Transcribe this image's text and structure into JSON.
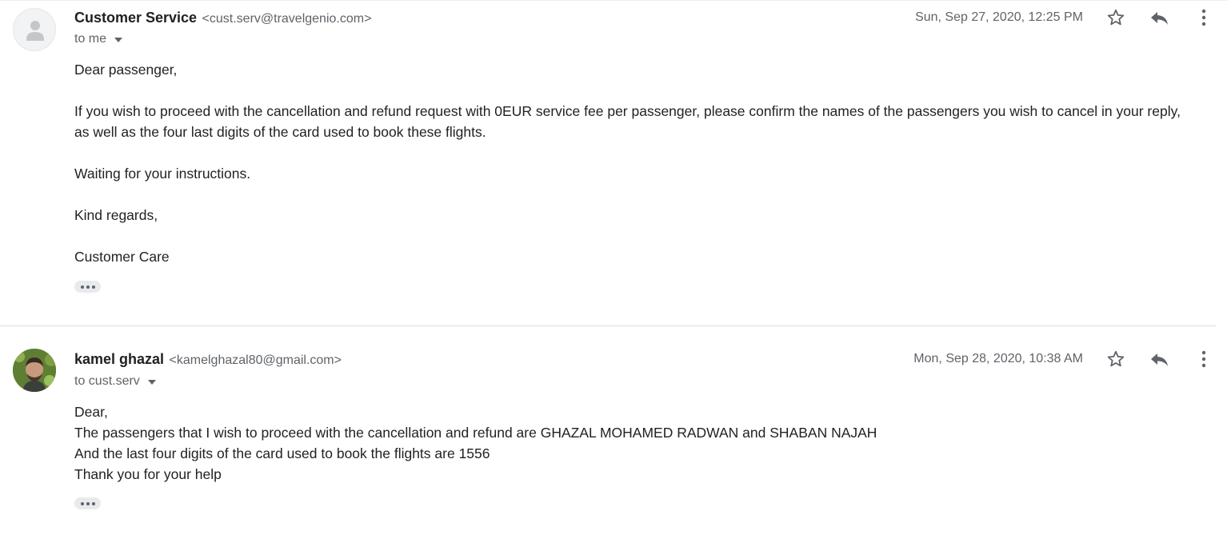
{
  "messages": [
    {
      "sender_name": "Customer Service",
      "sender_email": "<cust.serv@travelgenio.com>",
      "to": "to me",
      "date": "Sun, Sep 27, 2020, 12:25 PM",
      "body": {
        "greeting": "Dear passenger,",
        "para1_line1": "If you wish to proceed with the cancellation and refund request with 0EUR service fee per passenger, please confirm the names of the passengers you wish to cancel in your reply,",
        "para1_line2": "as well as the four last digits of the card used to book these flights.",
        "para2": "Waiting for your instructions.",
        "para3": "Kind regards,",
        "signature": "Customer Care"
      }
    },
    {
      "sender_name": "kamel ghazal",
      "sender_email": "<kamelghazal80@gmail.com>",
      "to": "to cust.serv",
      "date": "Mon, Sep 28, 2020, 10:38 AM",
      "body": {
        "line1": "Dear,",
        "line2": "The passengers that I wish to proceed with the cancellation and refund are GHAZAL MOHAMED RADWAN and SHABAN NAJAH",
        "line3": "And the last four digits of the card used to book the flights are 1556",
        "line4": "Thank you for your help"
      }
    }
  ],
  "colors": {
    "text": "#222222",
    "secondary": "#5f6368",
    "divider": "#dadce0",
    "dots_bg": "#e8eaed"
  },
  "icons": {
    "star": "star-icon",
    "reply": "reply-icon",
    "more": "more-vert-icon",
    "caret": "caret-down-icon",
    "avatar_default": "person-icon"
  }
}
